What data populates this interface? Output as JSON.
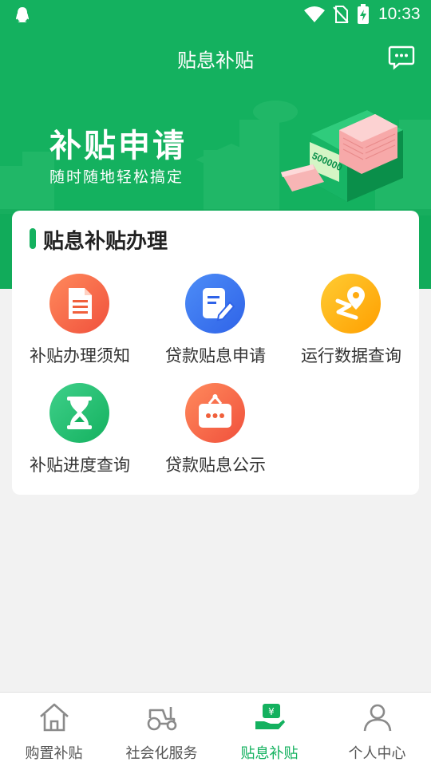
{
  "status_bar": {
    "time": "10:33"
  },
  "header": {
    "title": "贴息补贴"
  },
  "banner": {
    "title": "补贴申请",
    "subtitle": "随时随地轻松搞定",
    "bill_amount": "500000"
  },
  "card": {
    "title": "贴息补贴办理",
    "services": [
      {
        "label": "补贴办理须知",
        "icon": "document-icon",
        "color_from": "#ff8a5c",
        "color_to": "#f0503c"
      },
      {
        "label": "贷款贴息申请",
        "icon": "edit-form-icon",
        "color_from": "#4d8df7",
        "color_to": "#2f63e8"
      },
      {
        "label": "运行数据查询",
        "icon": "route-pin-icon",
        "color_from": "#ffcc33",
        "color_to": "#ff9f00"
      },
      {
        "label": "补贴进度查询",
        "icon": "hourglass-icon",
        "color_from": "#3fd08a",
        "color_to": "#14b15f"
      },
      {
        "label": "贷款贴息公示",
        "icon": "notice-board-icon",
        "color_from": "#ff8a5c",
        "color_to": "#f0503c"
      }
    ]
  },
  "tabbar": {
    "items": [
      {
        "label": "购置补贴",
        "icon": "house-icon",
        "active": false
      },
      {
        "label": "社会化服务",
        "icon": "tractor-icon",
        "active": false
      },
      {
        "label": "贴息补贴",
        "icon": "hand-yen-icon",
        "active": true
      },
      {
        "label": "个人中心",
        "icon": "person-icon",
        "active": false
      }
    ]
  },
  "colors": {
    "brand_green": "#14b15f",
    "tab_inactive": "#555555",
    "background": "#f2f2f2"
  }
}
